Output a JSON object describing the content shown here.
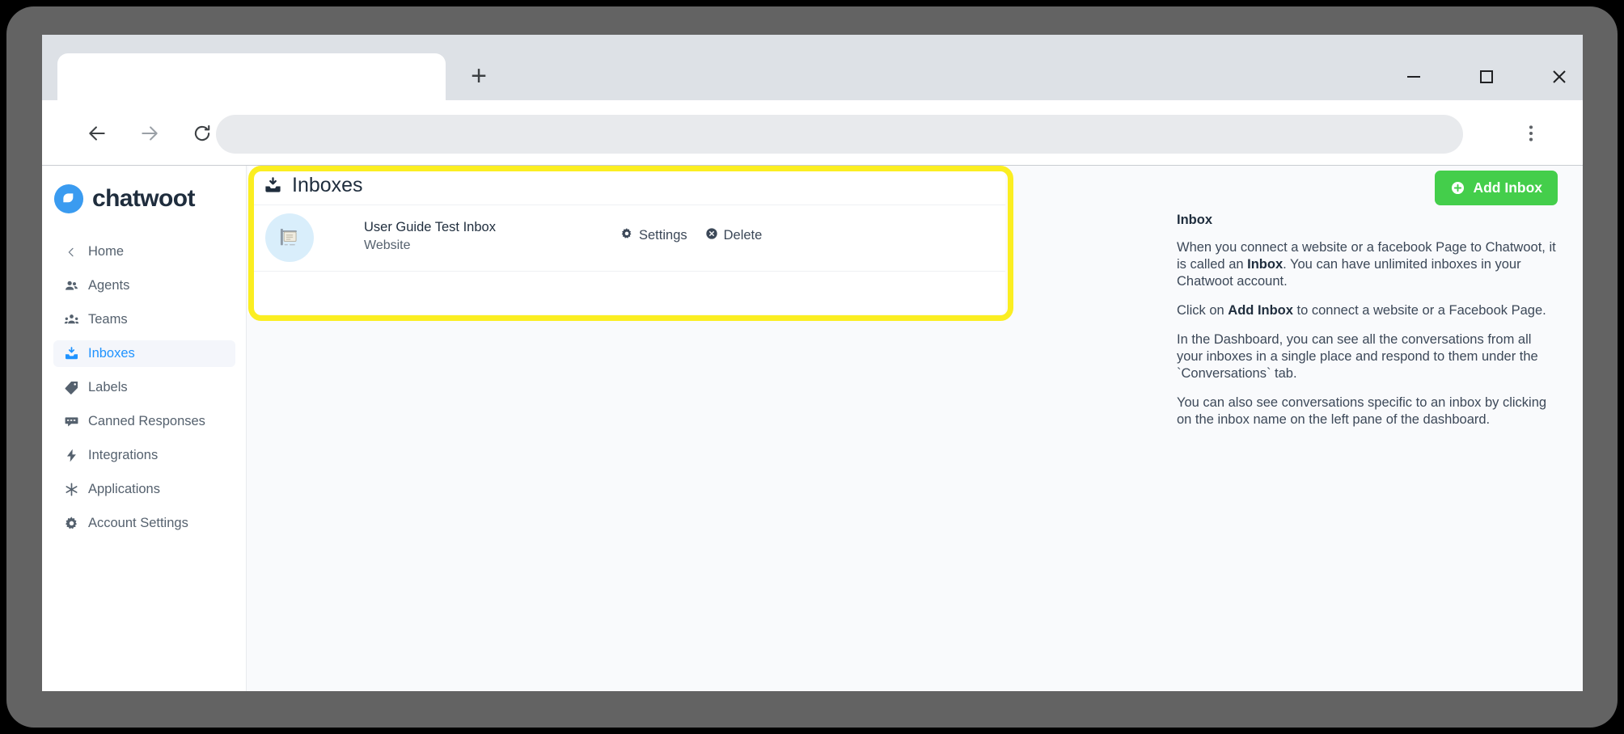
{
  "browser": {
    "tab_title": "",
    "new_tab_label": "+",
    "address_value": "",
    "address_placeholder": "",
    "window_controls": {
      "minimize": "minimize-icon",
      "maximize": "maximize-icon",
      "close": "close-icon"
    },
    "nav": {
      "back": "back-arrow-icon",
      "forward": "forward-arrow-icon",
      "reload": "reload-icon",
      "menu": "kebab-menu-icon"
    }
  },
  "sidebar": {
    "brand_name": "chatwoot",
    "brand_logo": "chatwoot-logo-icon",
    "items": [
      {
        "label": "Home",
        "icon": "chevron-left-icon",
        "active": false
      },
      {
        "label": "Agents",
        "icon": "agents-icon",
        "active": false
      },
      {
        "label": "Teams",
        "icon": "teams-icon",
        "active": false
      },
      {
        "label": "Inboxes",
        "icon": "inbox-tray-icon",
        "active": true
      },
      {
        "label": "Labels",
        "icon": "label-tag-icon",
        "active": false
      },
      {
        "label": "Canned Responses",
        "icon": "canned-response-icon",
        "active": false
      },
      {
        "label": "Integrations",
        "icon": "lightning-bolt-icon",
        "active": false
      },
      {
        "label": "Applications",
        "icon": "asterisk-icon",
        "active": false
      },
      {
        "label": "Account Settings",
        "icon": "gear-icon",
        "active": false
      }
    ]
  },
  "main": {
    "panel_title": "Inboxes",
    "panel_icon": "inbox-tray-icon",
    "add_inbox_label": "Add Inbox",
    "add_inbox_icon": "plus-circle-icon",
    "inboxes": [
      {
        "name": "User Guide Test Inbox",
        "channel": "Website",
        "avatar_icon": "website-signboard-icon",
        "actions": [
          {
            "label": "Settings",
            "icon": "gear-icon"
          },
          {
            "label": "Delete",
            "icon": "delete-circle-icon"
          }
        ]
      }
    ]
  },
  "help": {
    "title": "Inbox",
    "paragraphs": [
      "When you connect a website or a facebook Page to Chatwoot, it is called an |Inbox|. You can have unlimited inboxes in your Chatwoot account.",
      "Click on |Add Inbox| to connect a website or a Facebook Page.",
      "In the Dashboard, you can see all the conversations from all your inboxes in a single place and respond to them under the `Conversations` tab.",
      "You can also see conversations specific to an inbox by clicking on the inbox name on the left pane of the dashboard."
    ]
  },
  "colors": {
    "accent_blue": "#1f93ff",
    "add_inbox_green": "#44ce4b",
    "annotation_yellow": "#fbee21",
    "avatar_blue": "#d9eefb",
    "frame_gray": "#636363"
  }
}
